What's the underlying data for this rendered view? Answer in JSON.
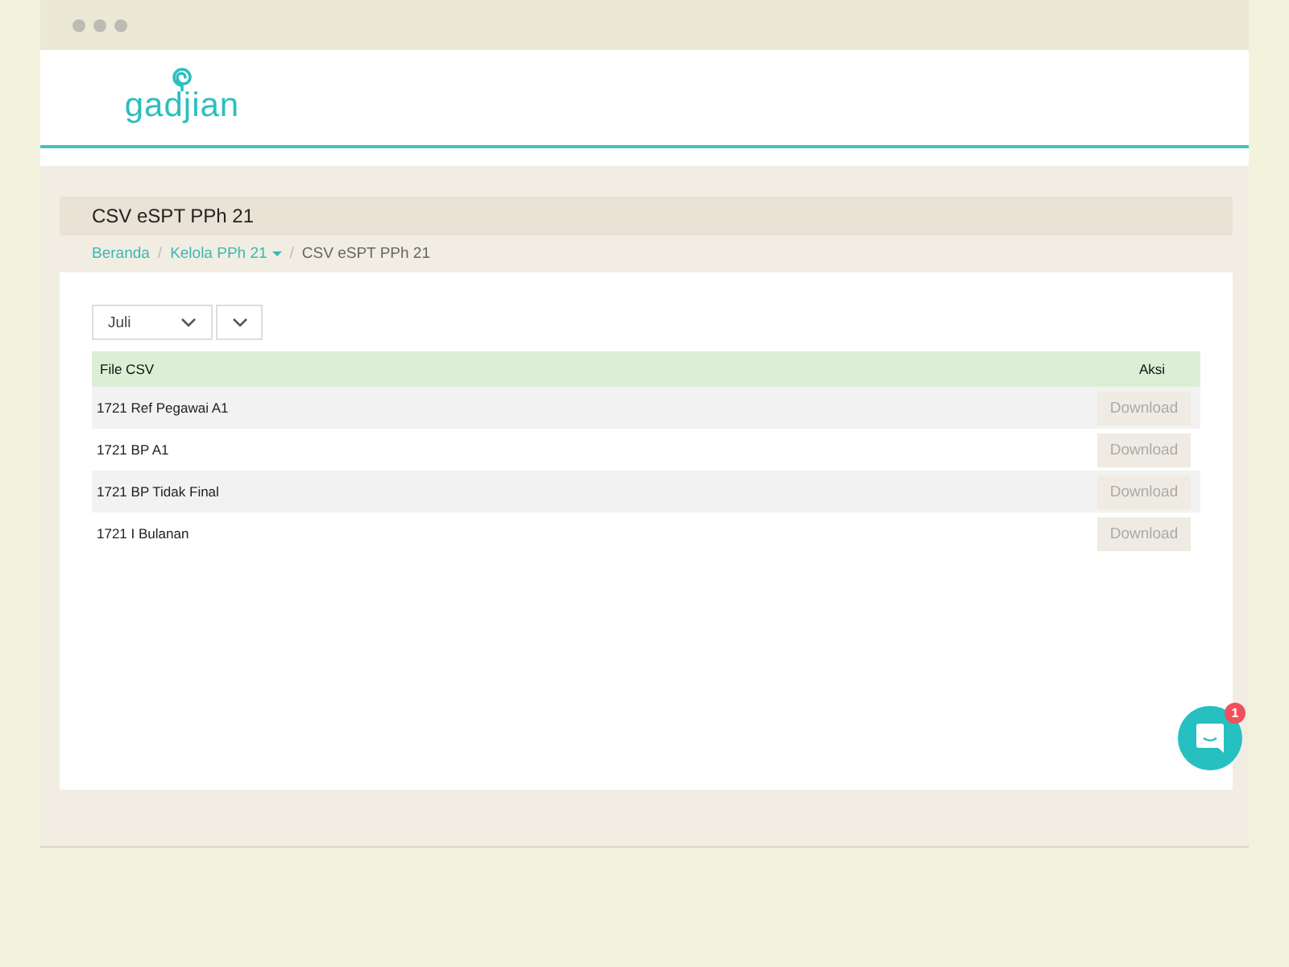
{
  "window": {
    "controls": [
      {
        "kind": "dot"
      },
      {
        "kind": "dot"
      },
      {
        "kind": "dot"
      }
    ]
  },
  "header": {
    "logo": "gadjian"
  },
  "page_title": "CSV eSPT PPh 21",
  "breadcrumb": [
    {
      "label": "Beranda",
      "kind": "link"
    },
    {
      "kind": "separator",
      "label": "/"
    },
    {
      "label": "Kelola PPh 21",
      "kind": "dropdown"
    },
    {
      "kind": "separator",
      "label": "/"
    },
    {
      "label": "CSV eSPT PPh 21",
      "kind": "current"
    }
  ],
  "filters": [
    {
      "kind": "wide",
      "value": "Juli"
    },
    {
      "kind": "narrow"
    }
  ],
  "table": {
    "columns": [
      "File CSV",
      "Aksi"
    ],
    "rows": [
      {
        "name": "1721 Ref Pegawai A1",
        "action": "Download",
        "disabled": true
      },
      {
        "name": "1721 BP A1",
        "action": "Download",
        "disabled": true
      },
      {
        "name": "1721 BP Tidak Final",
        "action": "Download",
        "disabled": true
      },
      {
        "name": "1721 I Bulanan",
        "action": "Download",
        "disabled": true
      }
    ]
  },
  "chat": {
    "badge": "1"
  }
}
